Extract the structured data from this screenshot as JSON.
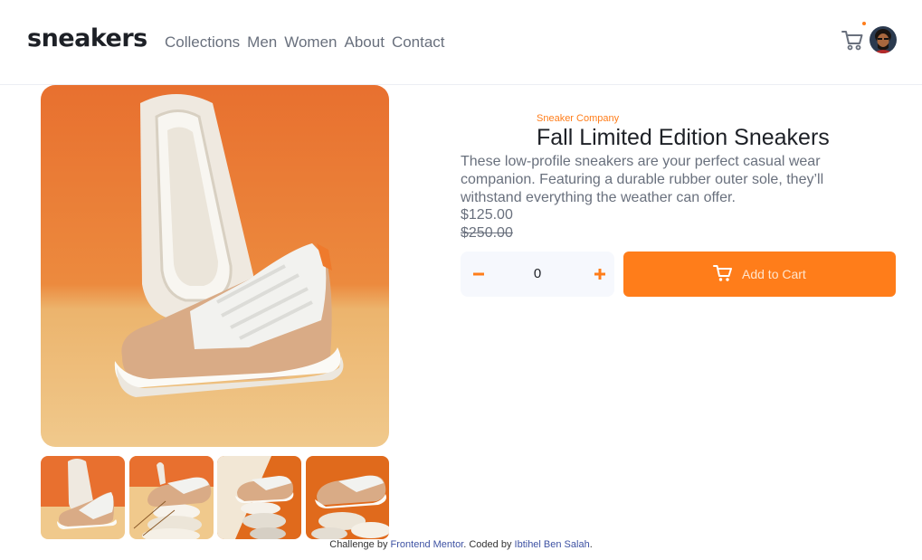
{
  "header": {
    "logo": "sneakers",
    "nav": [
      "Collections",
      "Men",
      "Women",
      "About",
      "Contact"
    ],
    "cart_icon": "cart-icon",
    "avatar_icon": "avatar"
  },
  "product": {
    "company": "Sneaker Company",
    "title": "Fall Limited Edition Sneakers",
    "description": "These low-profile sneakers are your perfect casual wear companion. Featuring a durable rubber outer sole, they’ll withstand everything the weather can offer.",
    "price": "$125.00",
    "old_price": "$250.00"
  },
  "quantity": {
    "value": "0",
    "minus_icon": "minus-icon",
    "plus_icon": "plus-icon"
  },
  "cart_button": {
    "label": "Add to Cart",
    "icon": "cart-icon"
  },
  "footer": {
    "prefix": "Challenge by",
    "challenge_link": "Frontend Mentor",
    "middle": ". Coded by",
    "author_link": "Ibtihel Ben Salah",
    "suffix": "."
  },
  "colors": {
    "accent": "#ff7d1a",
    "text_dark": "#1d2026",
    "text_muted": "#69707d",
    "qty_bg": "#f6f8fd"
  }
}
